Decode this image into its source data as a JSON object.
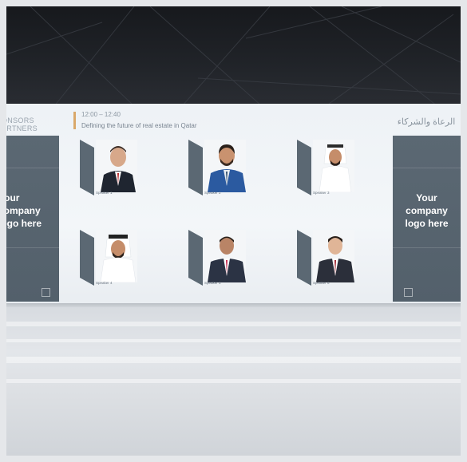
{
  "left_sponsor": {
    "header_line1": "ONSORS",
    "header_line2": "ARTNERS",
    "panel_text": "Your company logo here"
  },
  "right_sponsor": {
    "header": "الرعاة والشركاء",
    "panel_text": "Your company logo here"
  },
  "session": {
    "time": "12:00 – 12:40",
    "title": "Defining the future of real estate in Qatar"
  },
  "speakers": [
    {
      "name": "Speaker 1"
    },
    {
      "name": "Speaker 2"
    },
    {
      "name": "Speaker 3"
    },
    {
      "name": "Speaker 4"
    },
    {
      "name": "Speaker 5"
    },
    {
      "name": "Speaker 6"
    }
  ]
}
